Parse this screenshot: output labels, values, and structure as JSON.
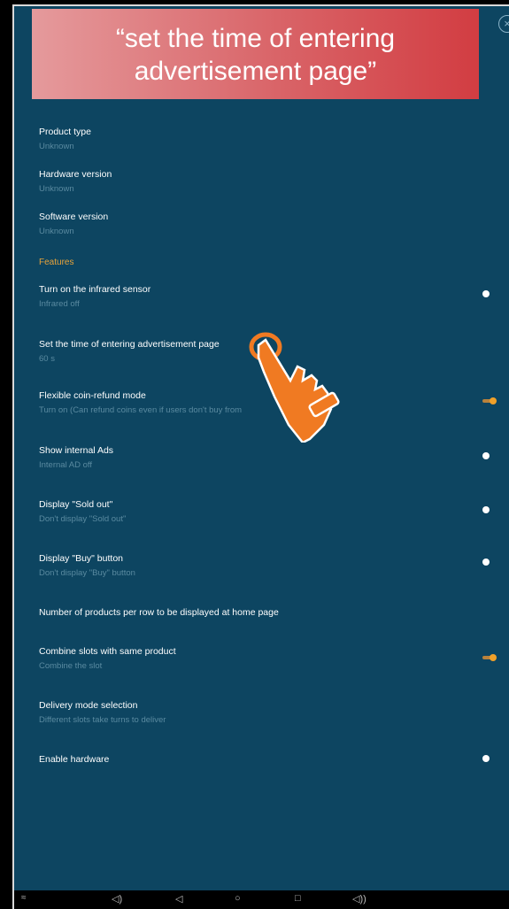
{
  "banner": {
    "line1": "“set the time of entering",
    "line2": "advertisement page”"
  },
  "settings": {
    "product_type": {
      "title": "Product type",
      "sub": "Unknown"
    },
    "hardware_version": {
      "title": "Hardware version",
      "sub": "Unknown"
    },
    "software_version": {
      "title": "Software version",
      "sub": "Unknown"
    },
    "features_header": "Features",
    "infrared": {
      "title": "Turn on the infrared sensor",
      "sub": "Infrared off",
      "on": false
    },
    "ad_time": {
      "title": "Set the time of entering advertisement page",
      "sub": "60 s"
    },
    "coin_refund": {
      "title": "Flexible coin-refund mode",
      "sub": "Turn on (Can refund coins even if users don't buy from",
      "on": true
    },
    "internal_ads": {
      "title": "Show internal Ads",
      "sub": "Internal AD off",
      "on": false
    },
    "sold_out": {
      "title": "Display \"Sold out\"",
      "sub": "Don't display \"Sold out\"",
      "on": false
    },
    "buy_button": {
      "title": "Display \"Buy\" button",
      "sub": "Don't display \"Buy\" button",
      "on": false
    },
    "products_per_row": {
      "title": "Number of products per row to be displayed at home page"
    },
    "combine_slots": {
      "title": "Combine slots with same product",
      "sub": "Combine the slot",
      "on": true
    },
    "delivery_mode": {
      "title": "Delivery mode selection",
      "sub": "Different slots take turns to deliver"
    },
    "enable_hardware": {
      "title": "Enable hardware",
      "on": false
    }
  },
  "colors": {
    "background": "#0d4561",
    "accent": "#f0a12a",
    "banner": "#d23d42"
  },
  "navbar_icons": [
    "chevron-down-icon",
    "volume-down-icon",
    "back-icon",
    "home-icon",
    "recents-icon",
    "volume-up-icon"
  ]
}
